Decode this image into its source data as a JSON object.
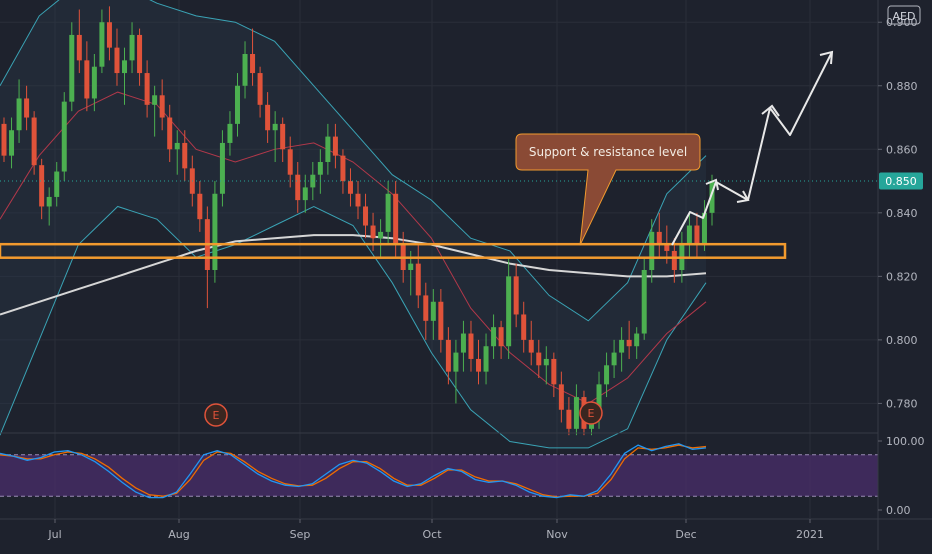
{
  "chart_data": {
    "type": "candlestick",
    "currency": "AED",
    "price_axis": {
      "range": [
        0.771,
        0.907
      ],
      "ticks": [
        "0.900",
        "0.880",
        "0.860",
        "0.840",
        "0.820",
        "0.800",
        "0.780"
      ]
    },
    "last_price": {
      "value": 0.85,
      "label": "0.850",
      "color": "#26a69a"
    },
    "x_axis": {
      "ticks": [
        "Jul",
        "Aug",
        "Sep",
        "Oct",
        "Nov",
        "Dec",
        "2021"
      ]
    },
    "candles": [
      [
        0.868,
        0.87,
        0.856,
        0.858
      ],
      [
        0.858,
        0.87,
        0.854,
        0.866
      ],
      [
        0.866,
        0.882,
        0.862,
        0.876
      ],
      [
        0.876,
        0.88,
        0.866,
        0.87
      ],
      [
        0.87,
        0.872,
        0.852,
        0.855
      ],
      [
        0.855,
        0.857,
        0.838,
        0.842
      ],
      [
        0.842,
        0.848,
        0.836,
        0.845
      ],
      [
        0.845,
        0.856,
        0.842,
        0.853
      ],
      [
        0.853,
        0.878,
        0.85,
        0.875
      ],
      [
        0.875,
        0.9,
        0.872,
        0.896
      ],
      [
        0.896,
        0.904,
        0.884,
        0.888
      ],
      [
        0.888,
        0.894,
        0.872,
        0.876
      ],
      [
        0.876,
        0.89,
        0.872,
        0.886
      ],
      [
        0.886,
        0.904,
        0.884,
        0.9
      ],
      [
        0.9,
        0.905,
        0.888,
        0.892
      ],
      [
        0.892,
        0.898,
        0.88,
        0.884
      ],
      [
        0.884,
        0.892,
        0.874,
        0.888
      ],
      [
        0.888,
        0.9,
        0.884,
        0.896
      ],
      [
        0.896,
        0.898,
        0.88,
        0.884
      ],
      [
        0.884,
        0.888,
        0.87,
        0.874
      ],
      [
        0.874,
        0.88,
        0.864,
        0.877
      ],
      [
        0.877,
        0.882,
        0.866,
        0.87
      ],
      [
        0.87,
        0.874,
        0.856,
        0.86
      ],
      [
        0.86,
        0.866,
        0.852,
        0.862
      ],
      [
        0.862,
        0.866,
        0.85,
        0.854
      ],
      [
        0.854,
        0.858,
        0.842,
        0.846
      ],
      [
        0.846,
        0.85,
        0.834,
        0.838
      ],
      [
        0.838,
        0.842,
        0.81,
        0.822
      ],
      [
        0.822,
        0.85,
        0.818,
        0.846
      ],
      [
        0.846,
        0.866,
        0.842,
        0.862
      ],
      [
        0.862,
        0.872,
        0.858,
        0.868
      ],
      [
        0.868,
        0.884,
        0.864,
        0.88
      ],
      [
        0.88,
        0.894,
        0.876,
        0.89
      ],
      [
        0.89,
        0.898,
        0.88,
        0.884
      ],
      [
        0.884,
        0.886,
        0.87,
        0.874
      ],
      [
        0.874,
        0.878,
        0.862,
        0.866
      ],
      [
        0.866,
        0.872,
        0.856,
        0.868
      ],
      [
        0.868,
        0.87,
        0.856,
        0.86
      ],
      [
        0.86,
        0.864,
        0.848,
        0.852
      ],
      [
        0.852,
        0.856,
        0.84,
        0.844
      ],
      [
        0.844,
        0.852,
        0.84,
        0.848
      ],
      [
        0.848,
        0.856,
        0.844,
        0.852
      ],
      [
        0.852,
        0.86,
        0.846,
        0.856
      ],
      [
        0.856,
        0.868,
        0.852,
        0.864
      ],
      [
        0.864,
        0.868,
        0.854,
        0.858
      ],
      [
        0.858,
        0.86,
        0.846,
        0.85
      ],
      [
        0.85,
        0.854,
        0.842,
        0.846
      ],
      [
        0.846,
        0.85,
        0.838,
        0.842
      ],
      [
        0.842,
        0.846,
        0.832,
        0.836
      ],
      [
        0.836,
        0.84,
        0.828,
        0.832
      ],
      [
        0.832,
        0.838,
        0.826,
        0.834
      ],
      [
        0.834,
        0.85,
        0.83,
        0.846
      ],
      [
        0.846,
        0.85,
        0.826,
        0.83
      ],
      [
        0.83,
        0.834,
        0.818,
        0.822
      ],
      [
        0.822,
        0.828,
        0.814,
        0.824
      ],
      [
        0.824,
        0.83,
        0.81,
        0.814
      ],
      [
        0.814,
        0.818,
        0.8,
        0.806
      ],
      [
        0.806,
        0.816,
        0.8,
        0.812
      ],
      [
        0.812,
        0.816,
        0.796,
        0.8
      ],
      [
        0.8,
        0.804,
        0.786,
        0.79
      ],
      [
        0.79,
        0.8,
        0.78,
        0.796
      ],
      [
        0.796,
        0.806,
        0.79,
        0.802
      ],
      [
        0.802,
        0.806,
        0.79,
        0.794
      ],
      [
        0.794,
        0.8,
        0.786,
        0.79
      ],
      [
        0.79,
        0.802,
        0.786,
        0.798
      ],
      [
        0.798,
        0.808,
        0.794,
        0.804
      ],
      [
        0.804,
        0.806,
        0.794,
        0.798
      ],
      [
        0.798,
        0.826,
        0.794,
        0.82
      ],
      [
        0.82,
        0.824,
        0.804,
        0.808
      ],
      [
        0.808,
        0.812,
        0.796,
        0.8
      ],
      [
        0.8,
        0.806,
        0.792,
        0.796
      ],
      [
        0.796,
        0.8,
        0.788,
        0.792
      ],
      [
        0.792,
        0.798,
        0.786,
        0.794
      ],
      [
        0.794,
        0.796,
        0.782,
        0.786
      ],
      [
        0.786,
        0.79,
        0.774,
        0.778
      ],
      [
        0.778,
        0.782,
        0.77,
        0.772
      ],
      [
        0.772,
        0.786,
        0.77,
        0.782
      ],
      [
        0.782,
        0.784,
        0.77,
        0.772
      ],
      [
        0.772,
        0.778,
        0.77,
        0.776
      ],
      [
        0.776,
        0.79,
        0.772,
        0.786
      ],
      [
        0.786,
        0.796,
        0.782,
        0.792
      ],
      [
        0.792,
        0.8,
        0.788,
        0.796
      ],
      [
        0.796,
        0.804,
        0.79,
        0.8
      ],
      [
        0.8,
        0.806,
        0.794,
        0.798
      ],
      [
        0.798,
        0.804,
        0.794,
        0.802
      ],
      [
        0.802,
        0.826,
        0.8,
        0.822
      ],
      [
        0.822,
        0.838,
        0.818,
        0.834
      ],
      [
        0.834,
        0.84,
        0.826,
        0.83
      ],
      [
        0.83,
        0.836,
        0.824,
        0.828
      ],
      [
        0.828,
        0.832,
        0.818,
        0.822
      ],
      [
        0.822,
        0.834,
        0.818,
        0.83
      ],
      [
        0.83,
        0.84,
        0.826,
        0.836
      ],
      [
        0.836,
        0.84,
        0.826,
        0.83
      ],
      [
        0.83,
        0.844,
        0.828,
        0.84
      ],
      [
        0.84,
        0.852,
        0.836,
        0.85
      ]
    ],
    "moving_averages": {
      "ma_200": {
        "color": "#d6d6d6",
        "values": [
          0.808,
          0.812,
          0.816,
          0.82,
          0.824,
          0.828,
          0.831,
          0.832,
          0.833,
          0.833,
          0.832,
          0.83,
          0.827,
          0.824,
          0.822,
          0.821,
          0.82,
          0.82,
          0.821
        ]
      },
      "ma_50": {
        "color": "#b2384a",
        "values": [
          0.838,
          0.858,
          0.872,
          0.878,
          0.874,
          0.86,
          0.856,
          0.86,
          0.862,
          0.856,
          0.846,
          0.832,
          0.81,
          0.796,
          0.786,
          0.78,
          0.788,
          0.802,
          0.812
        ]
      }
    },
    "bollinger": {
      "color": "#3aa3b5",
      "upper": [
        0.88,
        0.902,
        0.912,
        0.912,
        0.906,
        0.902,
        0.9,
        0.894,
        0.88,
        0.866,
        0.852,
        0.844,
        0.832,
        0.828,
        0.814,
        0.806,
        0.818,
        0.846,
        0.858
      ],
      "lower": [
        0.77,
        0.8,
        0.83,
        0.842,
        0.838,
        0.826,
        0.83,
        0.836,
        0.842,
        0.836,
        0.818,
        0.796,
        0.778,
        0.768,
        0.766,
        0.766,
        0.772,
        0.8,
        0.818
      ]
    },
    "support_resistance_band": {
      "label": "Support & resistance level",
      "low": 0.8265,
      "high": 0.8295,
      "color": "#f29a2e"
    },
    "earnings_markers": [
      "E",
      "E"
    ],
    "projection_arrows": [
      "wave up",
      "pull back",
      "rise"
    ],
    "stochastic": {
      "range": [
        0,
        100
      ],
      "ticks": [
        "100.00",
        "0.00"
      ],
      "overbought": 80,
      "oversold": 20,
      "k_color": "#2196f3",
      "d_color": "#ef6c00",
      "k": [
        82,
        78,
        72,
        76,
        84,
        86,
        80,
        70,
        56,
        40,
        26,
        18,
        18,
        26,
        52,
        80,
        86,
        80,
        66,
        52,
        42,
        36,
        34,
        38,
        52,
        66,
        72,
        68,
        56,
        42,
        34,
        38,
        50,
        60,
        56,
        44,
        40,
        42,
        36,
        26,
        20,
        18,
        22,
        20,
        28,
        52,
        82,
        94,
        86,
        92,
        96,
        88,
        90
      ],
      "d": [
        80,
        78,
        74,
        74,
        80,
        84,
        82,
        74,
        62,
        46,
        32,
        22,
        20,
        24,
        44,
        72,
        84,
        82,
        70,
        56,
        46,
        38,
        35,
        36,
        46,
        60,
        70,
        70,
        60,
        46,
        36,
        36,
        46,
        58,
        58,
        48,
        42,
        42,
        38,
        30,
        22,
        19,
        20,
        20,
        24,
        44,
        74,
        90,
        88,
        90,
        94,
        90,
        92
      ]
    }
  }
}
